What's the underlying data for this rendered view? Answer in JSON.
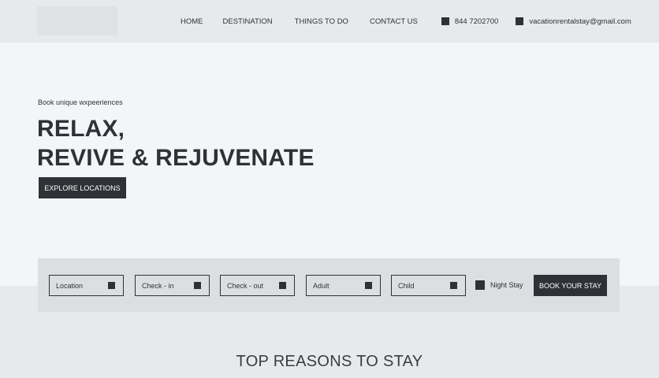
{
  "nav": {
    "home": "HOME",
    "destination": "DESTINATION",
    "things": "THINGS TO DO",
    "contact": "CONTACT US",
    "phone": "844 7202700",
    "email": "vacationrentalstay@gmail.com"
  },
  "hero": {
    "tagline": "Book unique wxpeeriences",
    "headline_line1": "RELAX,",
    "headline_line2": "REVIVE & REJUVENATE",
    "cta": "EXPLORE LOCATIONS"
  },
  "booking": {
    "location": "Location",
    "checkin": "Check - in",
    "checkout": "Check - out",
    "adult": "Adult",
    "child": "Child",
    "night_stay": "Night Stay",
    "submit": "BOOK YOUR STAY"
  },
  "sections": {
    "reasons_title": "TOP REASONS TO STAY"
  }
}
